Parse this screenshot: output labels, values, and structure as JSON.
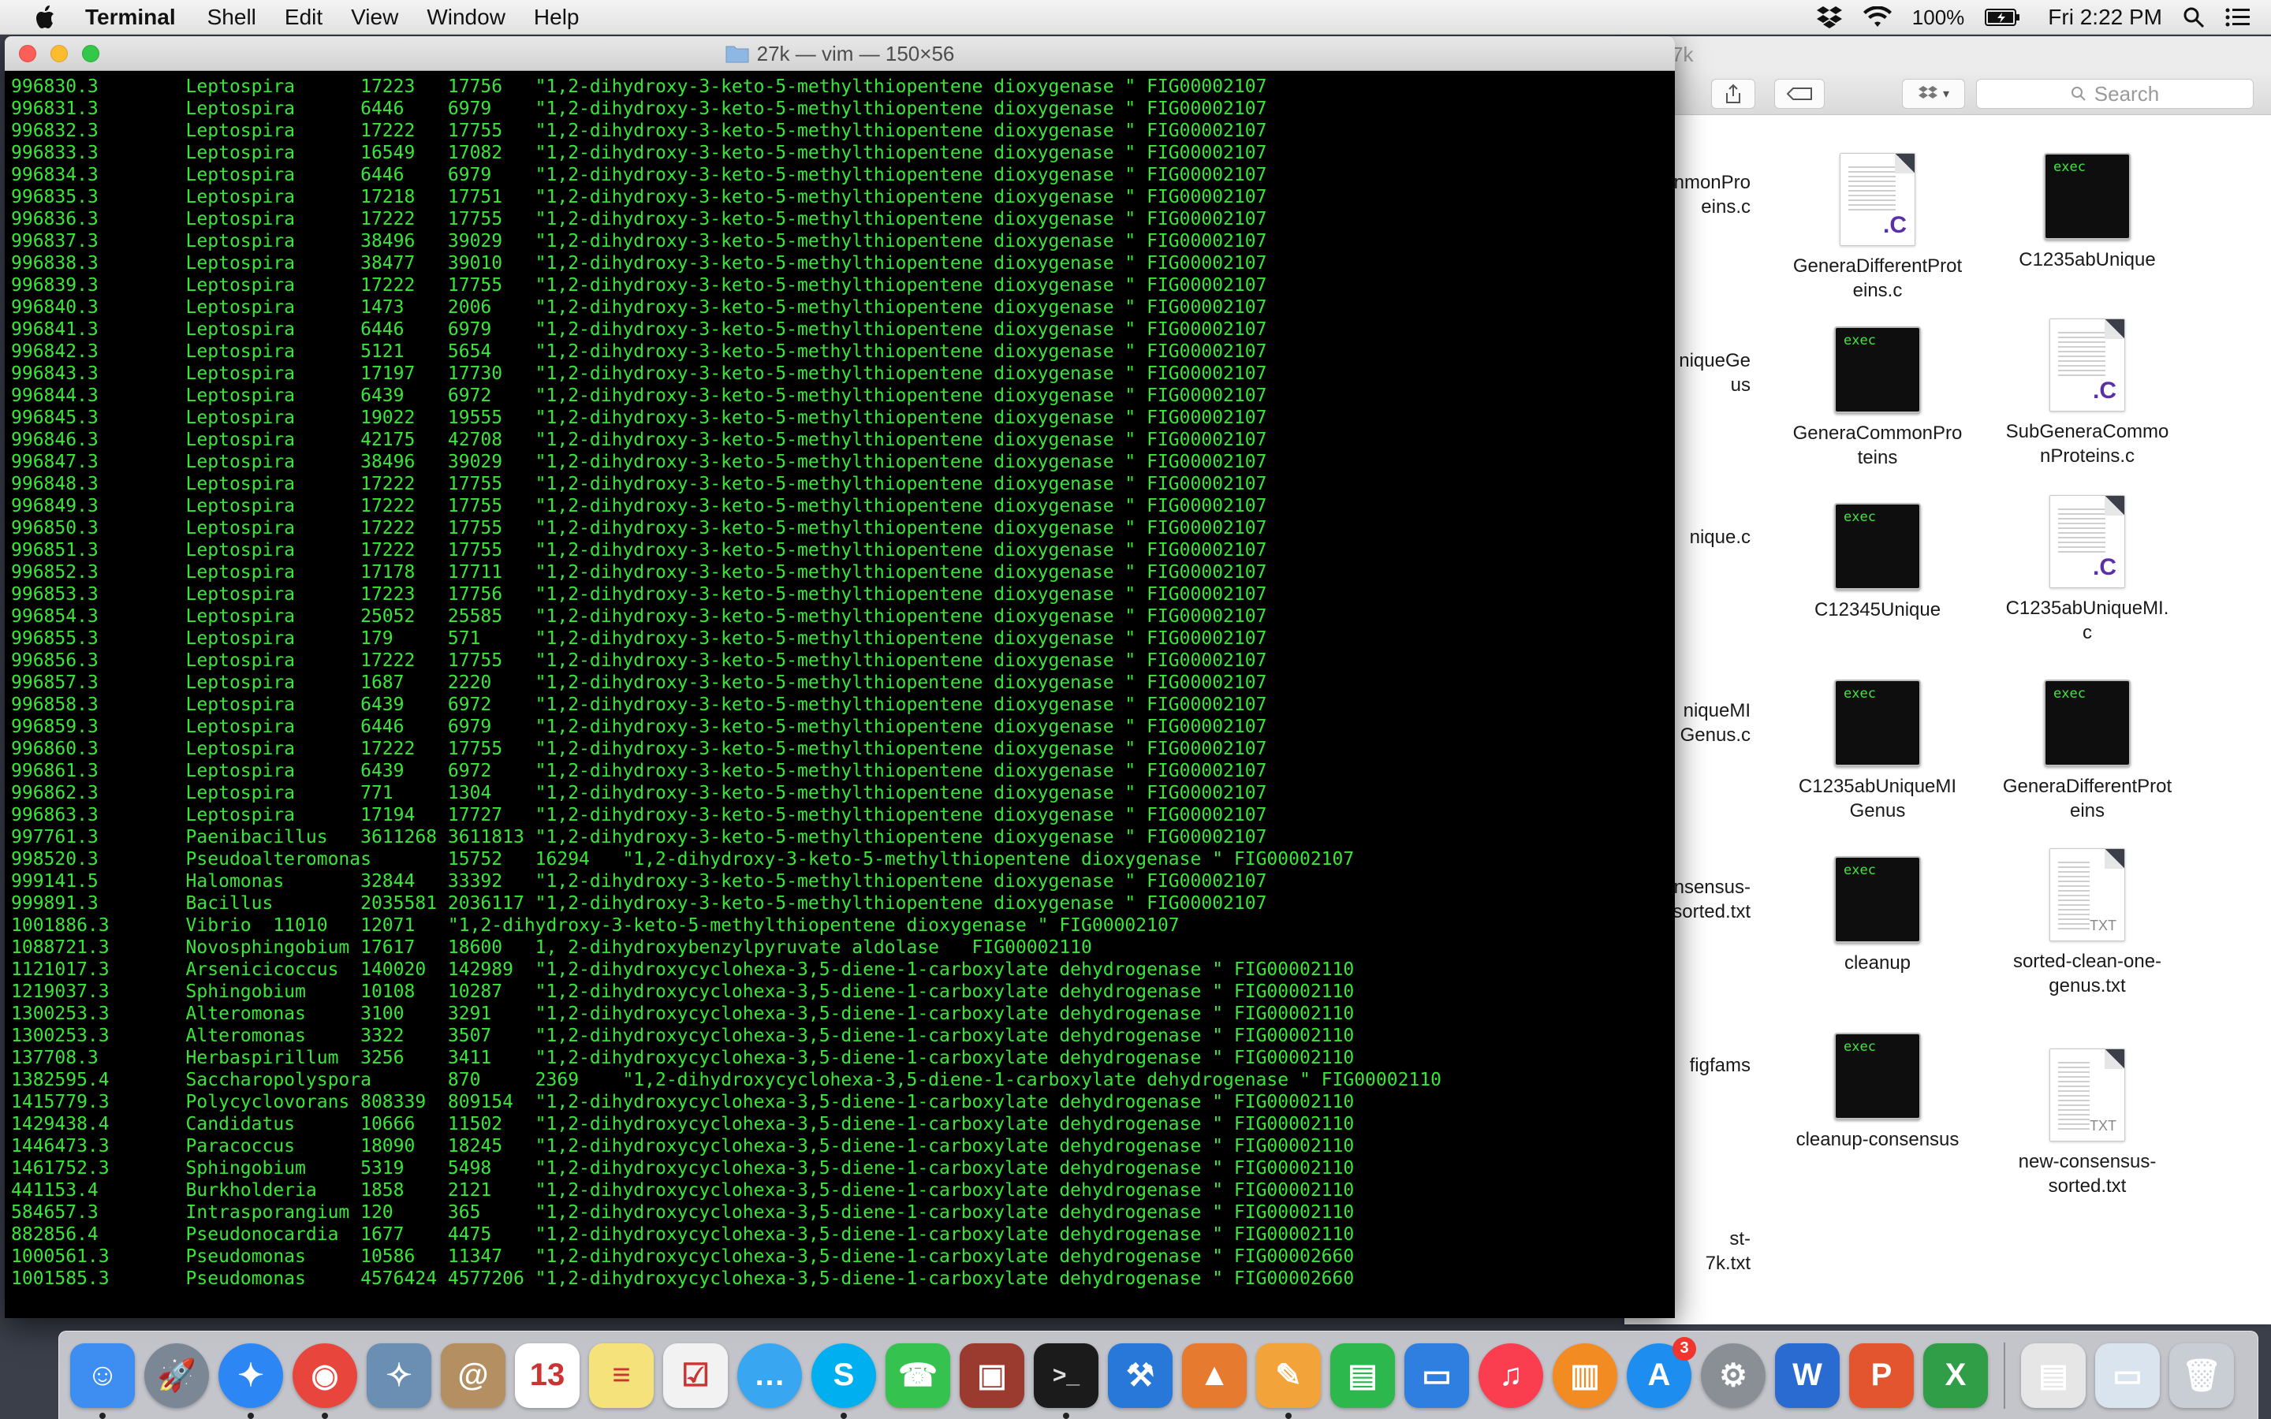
{
  "menubar": {
    "app_name": "Terminal",
    "items": [
      "Shell",
      "Edit",
      "View",
      "Window",
      "Help"
    ],
    "battery": "100%",
    "clock": "Fri 2:22 PM"
  },
  "finder": {
    "title_fragment": "7k",
    "search_placeholder": "Search",
    "files": [
      {
        "name": "GeneraDifferentProteins.c",
        "label": "GeneraDifferentProt\neins.c",
        "kind": "c"
      },
      {
        "name": "C1235abUnique",
        "label": "C1235abUnique",
        "kind": "exec"
      },
      {
        "name": "GeneraCommonProteins",
        "label": "GeneraCommonPro\nteins",
        "kind": "exec"
      },
      {
        "name": "SubGeneraCommonProteins.c",
        "label": "SubGeneraCommo\nnProteins.c",
        "kind": "c"
      },
      {
        "name": "C12345Unique",
        "label": "C12345Unique",
        "kind": "exec"
      },
      {
        "name": "C1235abUniqueMI.c",
        "label": "C1235abUniqueMI.\nc",
        "kind": "c"
      },
      {
        "name": "C1235abUniqueMIGenus",
        "label": "C1235abUniqueMI\nGenus",
        "kind": "exec"
      },
      {
        "name": "GeneraDifferentProteins",
        "label": "GeneraDifferentProt\neins",
        "kind": "exec"
      },
      {
        "name": "cleanup",
        "label": "cleanup",
        "kind": "exec"
      },
      {
        "name": "sorted-clean-one-genus.txt",
        "label": "sorted-clean-one-\ngenus.txt",
        "kind": "txt"
      },
      {
        "name": "cleanup-consensus",
        "label": "cleanup-consensus",
        "kind": "exec"
      },
      {
        "name": "new-consensus-sorted.txt",
        "label": "new-consensus-\nsorted.txt",
        "kind": "txt"
      }
    ],
    "partial_labels": [
      "nmonPro\neins.c",
      "niqueGe\nus",
      "nique.c",
      "niqueMI\nGenus.c",
      "nsensus-\nsorted.txt",
      "figfams",
      "st-\n7k.txt"
    ]
  },
  "icons": {
    "exec_text": "exec",
    "c_ext": ".C",
    "txt_ext": "TXT"
  },
  "terminal": {
    "title": "27k — vim — 150×56",
    "lines": [
      "996830.3        Leptospira      17223   17756   \"1,2-dihydroxy-3-keto-5-methylthiopentene dioxygenase \" FIG00002107",
      "996831.3        Leptospira      6446    6979    \"1,2-dihydroxy-3-keto-5-methylthiopentene dioxygenase \" FIG00002107",
      "996832.3        Leptospira      17222   17755   \"1,2-dihydroxy-3-keto-5-methylthiopentene dioxygenase \" FIG00002107",
      "996833.3        Leptospira      16549   17082   \"1,2-dihydroxy-3-keto-5-methylthiopentene dioxygenase \" FIG00002107",
      "996834.3        Leptospira      6446    6979    \"1,2-dihydroxy-3-keto-5-methylthiopentene dioxygenase \" FIG00002107",
      "996835.3        Leptospira      17218   17751   \"1,2-dihydroxy-3-keto-5-methylthiopentene dioxygenase \" FIG00002107",
      "996836.3        Leptospira      17222   17755   \"1,2-dihydroxy-3-keto-5-methylthiopentene dioxygenase \" FIG00002107",
      "996837.3        Leptospira      38496   39029   \"1,2-dihydroxy-3-keto-5-methylthiopentene dioxygenase \" FIG00002107",
      "996838.3        Leptospira      38477   39010   \"1,2-dihydroxy-3-keto-5-methylthiopentene dioxygenase \" FIG00002107",
      "996839.3        Leptospira      17222   17755   \"1,2-dihydroxy-3-keto-5-methylthiopentene dioxygenase \" FIG00002107",
      "996840.3        Leptospira      1473    2006    \"1,2-dihydroxy-3-keto-5-methylthiopentene dioxygenase \" FIG00002107",
      "996841.3        Leptospira      6446    6979    \"1,2-dihydroxy-3-keto-5-methylthiopentene dioxygenase \" FIG00002107",
      "996842.3        Leptospira      5121    5654    \"1,2-dihydroxy-3-keto-5-methylthiopentene dioxygenase \" FIG00002107",
      "996843.3        Leptospira      17197   17730   \"1,2-dihydroxy-3-keto-5-methylthiopentene dioxygenase \" FIG00002107",
      "996844.3        Leptospira      6439    6972    \"1,2-dihydroxy-3-keto-5-methylthiopentene dioxygenase \" FIG00002107",
      "996845.3        Leptospira      19022   19555   \"1,2-dihydroxy-3-keto-5-methylthiopentene dioxygenase \" FIG00002107",
      "996846.3        Leptospira      42175   42708   \"1,2-dihydroxy-3-keto-5-methylthiopentene dioxygenase \" FIG00002107",
      "996847.3        Leptospira      38496   39029   \"1,2-dihydroxy-3-keto-5-methylthiopentene dioxygenase \" FIG00002107",
      "996848.3        Leptospira      17222   17755   \"1,2-dihydroxy-3-keto-5-methylthiopentene dioxygenase \" FIG00002107",
      "996849.3        Leptospira      17222   17755   \"1,2-dihydroxy-3-keto-5-methylthiopentene dioxygenase \" FIG00002107",
      "996850.3        Leptospira      17222   17755   \"1,2-dihydroxy-3-keto-5-methylthiopentene dioxygenase \" FIG00002107",
      "996851.3        Leptospira      17222   17755   \"1,2-dihydroxy-3-keto-5-methylthiopentene dioxygenase \" FIG00002107",
      "996852.3        Leptospira      17178   17711   \"1,2-dihydroxy-3-keto-5-methylthiopentene dioxygenase \" FIG00002107",
      "996853.3        Leptospira      17223   17756   \"1,2-dihydroxy-3-keto-5-methylthiopentene dioxygenase \" FIG00002107",
      "996854.3        Leptospira      25052   25585   \"1,2-dihydroxy-3-keto-5-methylthiopentene dioxygenase \" FIG00002107",
      "996855.3        Leptospira      179     571     \"1,2-dihydroxy-3-keto-5-methylthiopentene dioxygenase \" FIG00002107",
      "996856.3        Leptospira      17222   17755   \"1,2-dihydroxy-3-keto-5-methylthiopentene dioxygenase \" FIG00002107",
      "996857.3        Leptospira      1687    2220    \"1,2-dihydroxy-3-keto-5-methylthiopentene dioxygenase \" FIG00002107",
      "996858.3        Leptospira      6439    6972    \"1,2-dihydroxy-3-keto-5-methylthiopentene dioxygenase \" FIG00002107",
      "996859.3        Leptospira      6446    6979    \"1,2-dihydroxy-3-keto-5-methylthiopentene dioxygenase \" FIG00002107",
      "996860.3        Leptospira      17222   17755   \"1,2-dihydroxy-3-keto-5-methylthiopentene dioxygenase \" FIG00002107",
      "996861.3        Leptospira      6439    6972    \"1,2-dihydroxy-3-keto-5-methylthiopentene dioxygenase \" FIG00002107",
      "996862.3        Leptospira      771     1304    \"1,2-dihydroxy-3-keto-5-methylthiopentene dioxygenase \" FIG00002107",
      "996863.3        Leptospira      17194   17727   \"1,2-dihydroxy-3-keto-5-methylthiopentene dioxygenase \" FIG00002107",
      "997761.3        Paenibacillus   3611268 3611813 \"1,2-dihydroxy-3-keto-5-methylthiopentene dioxygenase \" FIG00002107",
      "998520.3        Pseudoalteromonas       15752   16294   \"1,2-dihydroxy-3-keto-5-methylthiopentene dioxygenase \" FIG00002107",
      "999141.5        Halomonas       32844   33392   \"1,2-dihydroxy-3-keto-5-methylthiopentene dioxygenase \" FIG00002107",
      "999891.3        Bacillus        2035581 2036117 \"1,2-dihydroxy-3-keto-5-methylthiopentene dioxygenase \" FIG00002107",
      "1001886.3       Vibrio  11010   12071   \"1,2-dihydroxy-3-keto-5-methylthiopentene dioxygenase \" FIG00002107",
      "1088721.3       Novosphingobium 17617   18600   1, 2-dihydroxybenzylpyruvate aldolase   FIG00002110",
      "1121017.3       Arsenicicoccus  140020  142989  \"1,2-dihydroxycyclohexa-3,5-diene-1-carboxylate dehydrogenase \" FIG00002110",
      "1219037.3       Sphingobium     10108   10287   \"1,2-dihydroxycyclohexa-3,5-diene-1-carboxylate dehydrogenase \" FIG00002110",
      "1300253.3       Alteromonas     3100    3291    \"1,2-dihydroxycyclohexa-3,5-diene-1-carboxylate dehydrogenase \" FIG00002110",
      "1300253.3       Alteromonas     3322    3507    \"1,2-dihydroxycyclohexa-3,5-diene-1-carboxylate dehydrogenase \" FIG00002110",
      "137708.3        Herbaspirillum  3256    3411    \"1,2-dihydroxycyclohexa-3,5-diene-1-carboxylate dehydrogenase \" FIG00002110",
      "1382595.4       Saccharopolyspora       870     2369    \"1,2-dihydroxycyclohexa-3,5-diene-1-carboxylate dehydrogenase \" FIG00002110",
      "1415779.3       Polycyclovorans 808339  809154  \"1,2-dihydroxycyclohexa-3,5-diene-1-carboxylate dehydrogenase \" FIG00002110",
      "1429438.4       Candidatus      10666   11502   \"1,2-dihydroxycyclohexa-3,5-diene-1-carboxylate dehydrogenase \" FIG00002110",
      "1446473.3       Paracoccus      18090   18245   \"1,2-dihydroxycyclohexa-3,5-diene-1-carboxylate dehydrogenase \" FIG00002110",
      "1461752.3       Sphingobium     5319    5498    \"1,2-dihydroxycyclohexa-3,5-diene-1-carboxylate dehydrogenase \" FIG00002110",
      "441153.4        Burkholderia    1858    2121    \"1,2-dihydroxycyclohexa-3,5-diene-1-carboxylate dehydrogenase \" FIG00002110",
      "584657.3        Intrasporangium 120     365     \"1,2-dihydroxycyclohexa-3,5-diene-1-carboxylate dehydrogenase \" FIG00002110",
      "882856.4        Pseudonocardia  1677    4475    \"1,2-dihydroxycyclohexa-3,5-diene-1-carboxylate dehydrogenase \" FIG00002110",
      "1000561.3       Pseudomonas     10586   11347   \"1,2-dihydroxycyclohexa-3,5-diene-1-carboxylate dehydrogenase \" FIG00002660",
      "1001585.3       Pseudomonas     4576424 4577206 \"1,2-dihydroxycyclohexa-3,5-diene-1-carboxylate dehydrogenase \" FIG00002660"
    ]
  },
  "dock": {
    "apps": [
      {
        "name": "finder",
        "color": "#3d8ef0",
        "glyph": "☺",
        "running": true
      },
      {
        "name": "launchpad",
        "color": "#7c8796",
        "glyph": "🚀",
        "running": false
      },
      {
        "name": "safari",
        "color": "#2c87f5",
        "glyph": "✦",
        "running": true
      },
      {
        "name": "chrome",
        "color": "#e8453c",
        "glyph": "◉",
        "running": true
      },
      {
        "name": "preview",
        "color": "#6a8fb2",
        "glyph": "✧",
        "running": false
      },
      {
        "name": "contacts",
        "color": "#b38f62",
        "glyph": "@",
        "running": false
      },
      {
        "name": "calendar",
        "color": "#ffffff",
        "glyph": "13",
        "running": false
      },
      {
        "name": "notes",
        "color": "#f6e27a",
        "glyph": "≡",
        "running": false
      },
      {
        "name": "reminders",
        "color": "#f2f2f2",
        "glyph": "☑",
        "running": false
      },
      {
        "name": "messages",
        "color": "#39a6f2",
        "glyph": "…",
        "running": false
      },
      {
        "name": "skype",
        "color": "#00aff0",
        "glyph": "S",
        "running": true
      },
      {
        "name": "facetime",
        "color": "#35c24e",
        "glyph": "☎",
        "running": false
      },
      {
        "name": "photo-booth",
        "color": "#9b3b2f",
        "glyph": "▣",
        "running": false
      },
      {
        "name": "terminal",
        "color": "#1b1b1b",
        "glyph": ">_",
        "running": true
      },
      {
        "name": "xcode",
        "color": "#2778d9",
        "glyph": "⚒",
        "running": false
      },
      {
        "name": "matlab",
        "color": "#e67a2e",
        "glyph": "▲",
        "running": false
      },
      {
        "name": "pages",
        "color": "#f2a33a",
        "glyph": "✎",
        "running": true
      },
      {
        "name": "numbers",
        "color": "#2db84d",
        "glyph": "▤",
        "running": false
      },
      {
        "name": "keynote",
        "color": "#2f7fe0",
        "glyph": "▭",
        "running": false
      },
      {
        "name": "music",
        "color": "#fa3d4f",
        "glyph": "♫",
        "running": false
      },
      {
        "name": "ibooks",
        "color": "#f28b22",
        "glyph": "▥",
        "running": false
      },
      {
        "name": "app-store",
        "color": "#1d8ef0",
        "glyph": "A",
        "running": false,
        "badge": "3"
      },
      {
        "name": "system-preferences",
        "color": "#8a8f96",
        "glyph": "⚙",
        "running": false
      },
      {
        "name": "word",
        "color": "#2a6bd2",
        "glyph": "W",
        "running": false
      },
      {
        "name": "powerpoint",
        "color": "#e2552f",
        "glyph": "P",
        "running": false
      },
      {
        "name": "excel",
        "color": "#2f9e47",
        "glyph": "X",
        "running": false
      }
    ],
    "right_items": [
      {
        "name": "documents-stack",
        "color": "#e6e6e6",
        "glyph": "▤"
      },
      {
        "name": "downloads-stack",
        "color": "#d9e4ef",
        "glyph": "▭"
      },
      {
        "name": "trash",
        "color": "#c9ced4",
        "glyph": "🗑"
      }
    ]
  }
}
